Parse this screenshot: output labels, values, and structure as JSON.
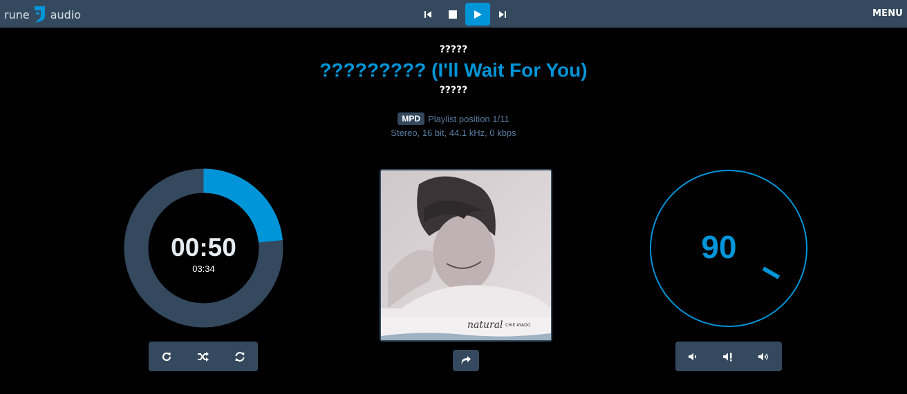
{
  "app": {
    "logo_left": "rune",
    "logo_right": "audio",
    "menu_label": "MENU"
  },
  "transport": {
    "buttons": [
      {
        "name": "previous",
        "icon": "skip-previous-icon"
      },
      {
        "name": "stop",
        "icon": "stop-icon"
      },
      {
        "name": "play",
        "icon": "play-icon",
        "active": true
      },
      {
        "name": "next",
        "icon": "skip-next-icon"
      }
    ]
  },
  "track": {
    "artist": "?????",
    "title": "????????? (I'll Wait For You)",
    "album": "?????",
    "source_badge": "MPD",
    "playlist_position": "Playlist position 1/11",
    "format": "Stereo, 16 bit, 44.1 kHz, 0 kbps"
  },
  "time": {
    "elapsed": "00:50",
    "total": "03:34",
    "progress_fraction": 0.234
  },
  "volume": {
    "value": "90",
    "level_fraction": 0.9
  },
  "playback_controls": [
    "repeat-icon",
    "shuffle-icon",
    "refresh-icon"
  ],
  "volume_controls": [
    "volume-down-icon",
    "mute-icon",
    "volume-up-icon"
  ],
  "cover": {
    "caption": "natural",
    "caption_small": "CHIE AYADO"
  },
  "colors": {
    "accent": "#0095d8",
    "bar": "#34495e",
    "background": "#000000",
    "meta_text": "#587ca0"
  }
}
